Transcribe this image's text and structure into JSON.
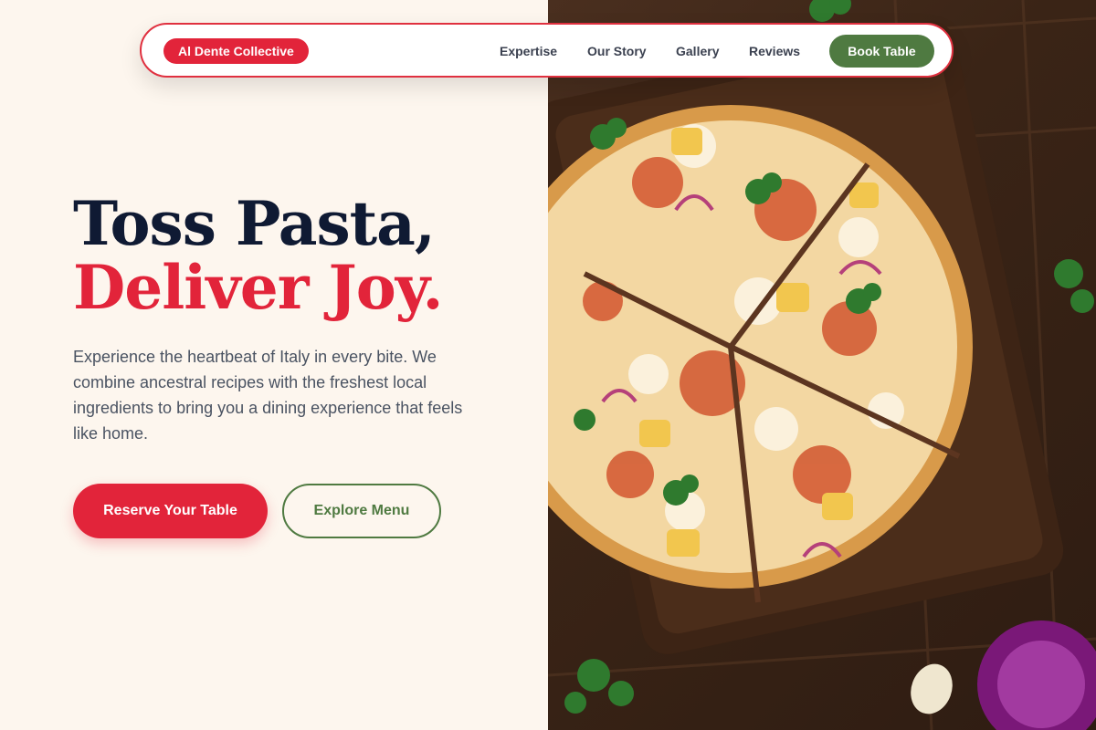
{
  "nav": {
    "brand": "Al Dente Collective",
    "links": [
      "Expertise",
      "Our Story",
      "Gallery",
      "Reviews"
    ],
    "cta": "Book Table"
  },
  "hero": {
    "title_line1": "Toss Pasta,",
    "title_line2": "Deliver Joy.",
    "description": "Experience the heartbeat of Italy in every bite. We combine ancestral recipes with the freshest local ingredients to bring you a dining experience that feels like home.",
    "primary_cta": "Reserve Your Table",
    "secondary_cta": "Explore Menu"
  },
  "colors": {
    "background": "#fdf6ee",
    "brand_red": "#e2243a",
    "accent_green": "#4f7a41",
    "heading_navy": "#0f1a33",
    "body_text": "#4a5362"
  },
  "image": {
    "subject": "pizza-on-wooden-board"
  }
}
